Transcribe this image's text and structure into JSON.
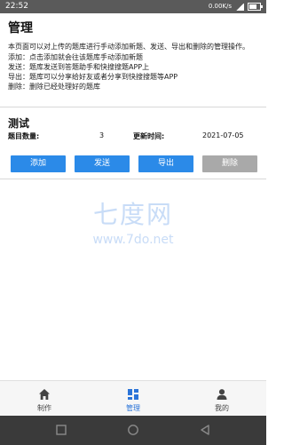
{
  "status": {
    "time": "22:52",
    "net_speed": "0.00K/s"
  },
  "header": {
    "title": "管理"
  },
  "description": {
    "intro": "本页面可以对上传的题库进行手动添加新题、发送、导出和删除的管理操作。",
    "lines": [
      "添加：点击添加就会往该题库手动添加新题",
      "发送：题库发送到答题助手和快搜搜题APP上",
      "导出：题库可以分享给好友或者分享到快搜搜题等APP",
      "删除：删除已经处理好的题库"
    ]
  },
  "bank": {
    "name": "测试",
    "count_label": "题目数量:",
    "count_value": "3",
    "updated_label": "更新时间:",
    "updated_value": "2021-07-05"
  },
  "actions": {
    "add": "添加",
    "send": "发送",
    "export": "导出",
    "delete": "删除"
  },
  "colors": {
    "primary": "#2b8ae8",
    "disabled": "#a9a9a9",
    "tab_active": "#2b74d8"
  },
  "watermark": {
    "big": "七度网",
    "small": "www.7do.net"
  },
  "tabs": [
    {
      "label": "制作",
      "icon": "home-icon"
    },
    {
      "label": "管理",
      "icon": "grid-icon",
      "active": true
    },
    {
      "label": "我的",
      "icon": "person-icon"
    }
  ]
}
